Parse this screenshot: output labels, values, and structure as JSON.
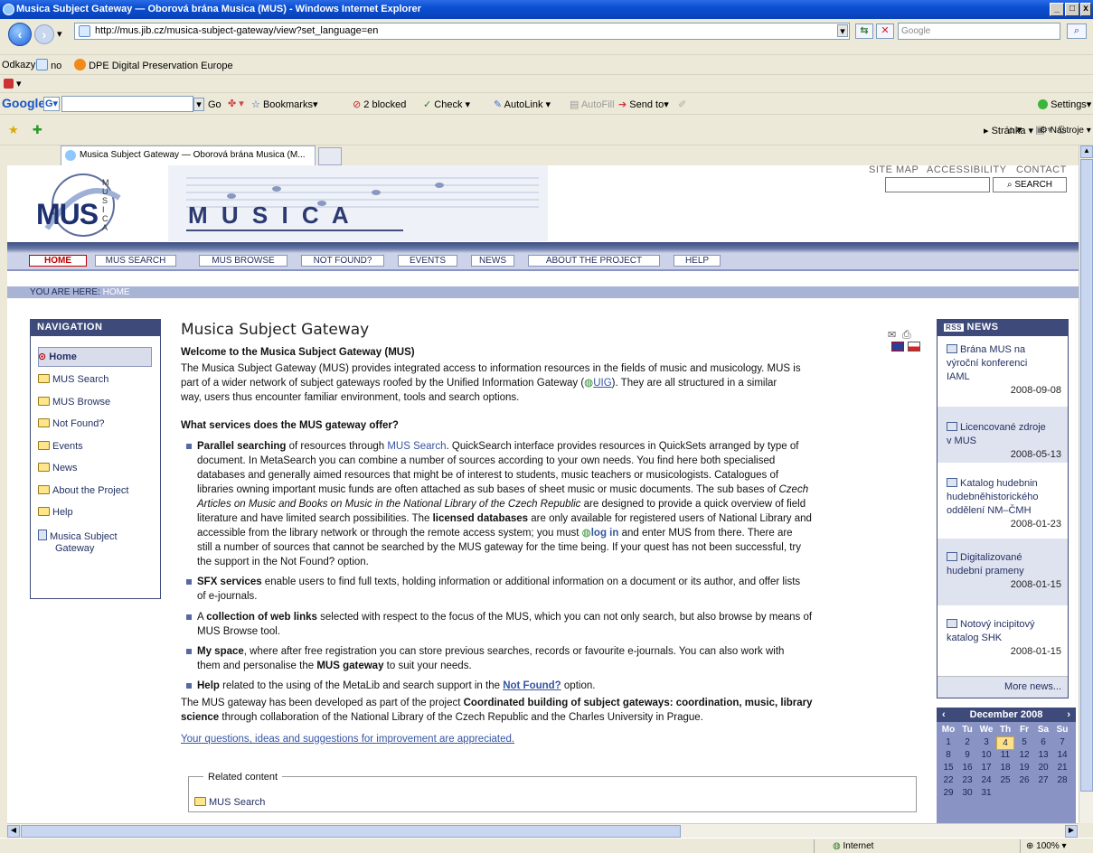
{
  "window": {
    "title": "Musica Subject Gateway — Oborová brána Musica (MUS) - Windows Internet Explorer",
    "min": "_",
    "max": "□",
    "close": "x"
  },
  "address": {
    "url": "http://mus.jib.cz/musica-subject-gateway/view?set_language=en",
    "search_placeholder": "Google"
  },
  "links_bar": {
    "label": "Odkazy",
    "items": [
      "no",
      "DPE Digital Preservation Europe"
    ]
  },
  "google_toolbar": {
    "logo": "Google",
    "go": "Go",
    "bookmarks": "Bookmarks▾",
    "blocked": "2 blocked",
    "check": "Check ▾",
    "autolink": "AutoLink ▾",
    "autofill": "AutoFill",
    "sendto": "Send to▾",
    "settings": "Settings▾"
  },
  "tab": {
    "title": "Musica Subject Gateway — Oborová brána Musica (M..."
  },
  "command_bar": {
    "page": "Stránka ▾",
    "tools": "Nástroje ▾"
  },
  "site": {
    "top_links": [
      "SITE MAP",
      "ACCESSIBILITY",
      "CONTACT"
    ],
    "search_button": "SEARCH",
    "logo_text": "MUS",
    "logo_side": "MUSICA",
    "banner_word": "M U S I C A",
    "menu": [
      "HOME",
      "MUS SEARCH",
      "MUS BROWSE",
      "NOT FOUND?",
      "EVENTS",
      "NEWS",
      "ABOUT THE PROJECT",
      "HELP"
    ],
    "breadcrumb_label": "YOU ARE HERE:",
    "breadcrumb_value": "HOME"
  },
  "navigation": {
    "heading": "NAVIGATION",
    "items": [
      "Home",
      "MUS Search",
      "MUS Browse",
      "Not Found?",
      "Events",
      "News",
      "About the Project",
      "Help",
      "Musica Subject",
      "Gateway"
    ]
  },
  "content": {
    "title": "Musica Subject Gateway",
    "welcome": "Welcome to the Musica Subject Gateway (MUS)",
    "intro_1": "The Musica Subject Gateway (MUS) provides integrated access to information resources in the fields of music and musicology. MUS is",
    "intro_2": "part of a wider network of subject gateways roofed by the Unified Information Gateway (",
    "intro_uig": "UIG",
    "intro_3": "). They are all structured in a similar",
    "intro_4": "way, users thus encounter familiar environment, tools and search options.",
    "services_heading": "What services does the MUS gateway offer?",
    "b1_strong": "Parallel searching",
    "b1_a": " of resources through ",
    "b1_link": "MUS Search",
    "b1_b": ". QuickSearch interface provides resources in QuickSets arranged by type of",
    "b1_l2": "document. In MetaSearch you can combine a number of sources according to your own needs. You find here both specialised",
    "b1_l3": "databases and generally aimed resources that might be of interest to students, music teachers or musicologists. Catalogues of",
    "b1_l4": "libraries owning important music funds are often attached as sub bases of sheet music or music documents. The sub bases of",
    "b1_l4i": " Czech",
    "b1_l5i": "Articles on Music and Books on Music in the National Library of the Czech Republic",
    "b1_l5": " are designed to provide a quick overview of field",
    "b1_l6a": "literature and have limited search possibilities. The ",
    "b1_l6s": "licensed databases",
    "b1_l6b": " are only available for registered users of National Library and",
    "b1_l7a": "accessible from the library network or through the remote access system; you must ",
    "b1_l7link": "log in",
    "b1_l7b": " and enter MUS from there. There are",
    "b1_l8": "still a number of sources that cannot be searched by the MUS gateway for the time being. If your quest has not been successful, try",
    "b1_l9": "the support in the Not Found? option.",
    "b2_strong": "SFX services",
    "b2_a": " enable users to find full texts, holding information or additional information on a document or its author, and offer lists",
    "b2_l2": "of e-journals.",
    "b3_a": "A ",
    "b3_strong": "collection of web links",
    "b3_b": " selected with respect to the focus of the MUS, which you can not only search, but also browse by means of",
    "b3_l2": "MUS Browse tool.",
    "b4_strong": "My space",
    "b4_a": ", where after free registration you can store previous searches, records or favourite e-journals. You can also work with",
    "b4_l2a": "them and personalise the ",
    "b4_l2s": "MUS gateway",
    "b4_l2b": " to suit your needs.",
    "b5_strong": "Help",
    "b5_a": " related to the using of the MetaLib and search support in the ",
    "b5_link": "Not Found?",
    "b5_b": " option.",
    "dev_a": "The MUS gateway has been developed as part of the project ",
    "dev_s1": "Coordinated building of subject gateways: coordination, music, library",
    "dev_s2": "science",
    "dev_b": " through collaboration of the National Library of the Czech Republic and the Charles University in Prague.",
    "feedback": "Your questions, ideas and suggestions for improvement are appreciated.",
    "related": "Related content",
    "related_item": "MUS Search"
  },
  "news": {
    "heading": "NEWS",
    "items": [
      {
        "l1": "Brána MUS na",
        "l2": "výroční konferenci",
        "l3": "IAML",
        "date": "2008-09-08"
      },
      {
        "l1": "Licencované zdroje",
        "l2": "v MUS",
        "l3": "",
        "date": "2008-05-13"
      },
      {
        "l1": "Katalog hudebnin",
        "l2": "hudebněhistorického",
        "l3": "oddělení NM–ČMH",
        "date": "2008-01-23"
      },
      {
        "l1": "Digitalizované",
        "l2": "hudební prameny",
        "l3": "",
        "date": "2008-01-15"
      },
      {
        "l1": "Notový incipitový",
        "l2": "katalog SHK",
        "l3": "",
        "date": "2008-01-15"
      }
    ],
    "more": "More news..."
  },
  "calendar": {
    "month": "December 2008",
    "days": [
      "Mo",
      "Tu",
      "We",
      "Th",
      "Fr",
      "Sa",
      "Su"
    ],
    "weeks": [
      [
        "1",
        "2",
        "3",
        "4",
        "5",
        "6",
        "7"
      ],
      [
        "8",
        "9",
        "10",
        "11",
        "12",
        "13",
        "14"
      ],
      [
        "15",
        "16",
        "17",
        "18",
        "19",
        "20",
        "21"
      ],
      [
        "22",
        "23",
        "24",
        "25",
        "26",
        "27",
        "28"
      ],
      [
        "29",
        "30",
        "31",
        "",
        "",
        "",
        ""
      ]
    ]
  },
  "status": {
    "zone": "Internet",
    "zoom": "100%"
  }
}
